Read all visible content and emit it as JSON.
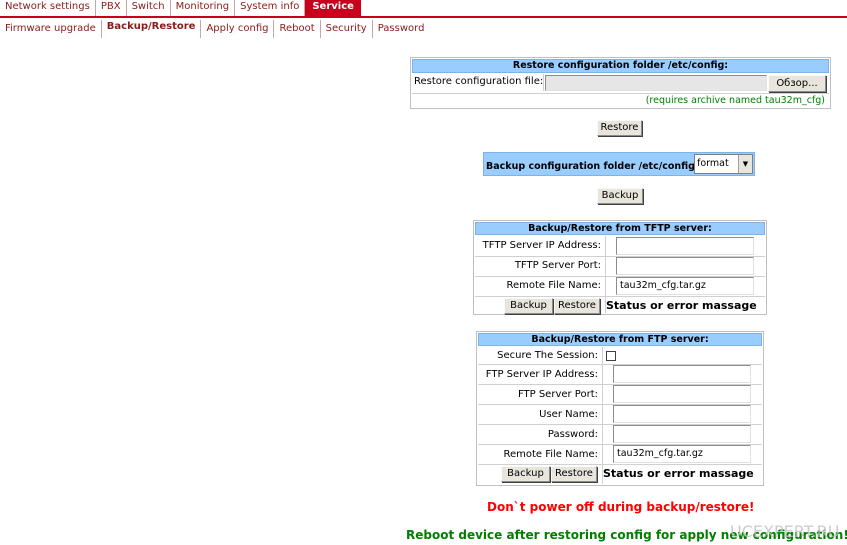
{
  "topmenu": {
    "items": [
      "Network settings",
      "PBX",
      "Switch",
      "Monitoring",
      "System info",
      "Service"
    ],
    "active": "Service"
  },
  "submenu": {
    "items": [
      "Firmware upgrade",
      "Backup/Restore",
      "Apply config",
      "Reboot",
      "Security",
      "Password"
    ],
    "active": "Backup/Restore"
  },
  "restore_section": {
    "title": "Restore configuration folder /etc/config:",
    "file_label": "Restore configuration file:",
    "browse_label": "Обзор...",
    "hint": "(requires archive named tau32m_cfg)",
    "restore_button": "Restore"
  },
  "backup_section": {
    "label": "Backup configuration folder /etc/config:",
    "select_value": "format",
    "backup_button": "Backup"
  },
  "tftp": {
    "title": "Backup/Restore from TFTP server:",
    "ip_label": "TFTP Server IP Address:",
    "ip_value": "",
    "port_label": "TFTP Server Port:",
    "port_value": "",
    "file_label": "Remote File Name:",
    "file_value": "tau32m_cfg.tar.gz",
    "backup_button": "Backup",
    "restore_button": "Restore",
    "status": "Status or error massage"
  },
  "ftp": {
    "title": "Backup/Restore from FTP server:",
    "secure_label": "Secure The Session:",
    "secure_checked": false,
    "ip_label": "FTP Server IP Address:",
    "port_label": "FTP Server Port:",
    "user_label": "User Name:",
    "password_label": "Password:",
    "file_label": "Remote File Name:",
    "file_value": "tau32m_cfg.tar.gz",
    "backup_button": "Backup",
    "restore_button": "Restore",
    "status": "Status or error massage"
  },
  "warnings": {
    "power": "Don`t power off during backup/restore!",
    "reboot": "Reboot device after restoring config for apply new configuration!"
  },
  "watermark": "UCEXPERT.RU",
  "colors": {
    "accent": "#c8001e",
    "header_blue": "#99ccff",
    "warning_red": "#ff0000",
    "note_green": "#008000"
  }
}
